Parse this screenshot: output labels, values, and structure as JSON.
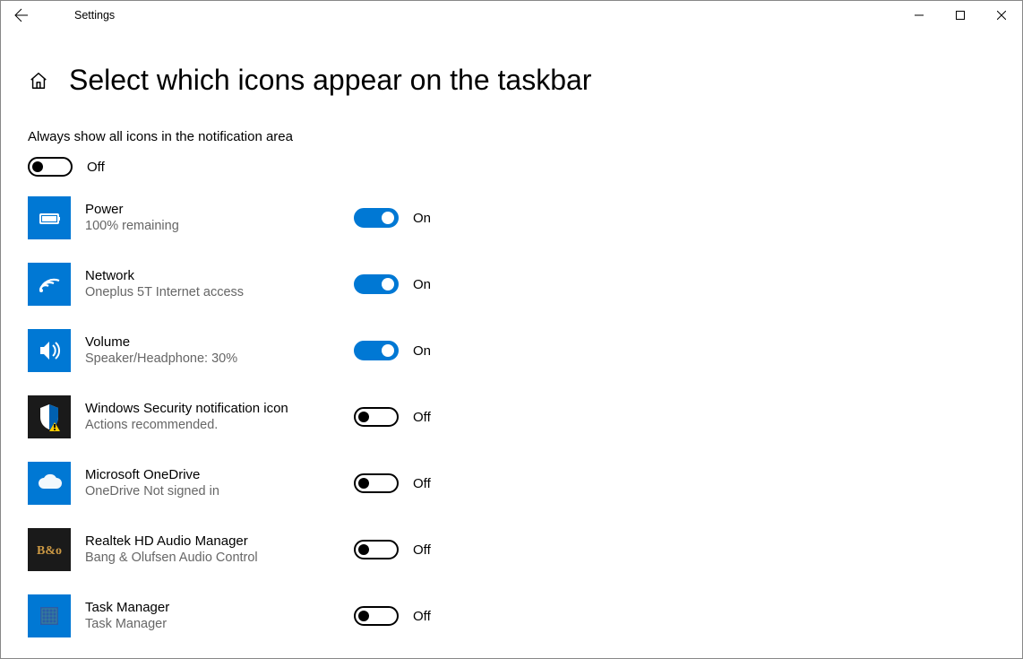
{
  "app_title": "Settings",
  "page_title": "Select which icons appear on the taskbar",
  "master": {
    "label": "Always show all icons in the notification area",
    "state": "Off",
    "on": false
  },
  "items": [
    {
      "title": "Power",
      "sub": "100% remaining",
      "state": "On",
      "on": true,
      "icon": "battery",
      "dark": false
    },
    {
      "title": "Network",
      "sub": "Oneplus 5T Internet access",
      "state": "On",
      "on": true,
      "icon": "wifi",
      "dark": false
    },
    {
      "title": "Volume",
      "sub": "Speaker/Headphone: 30%",
      "state": "On",
      "on": true,
      "icon": "speaker",
      "dark": false
    },
    {
      "title": "Windows Security notification icon",
      "sub": "Actions recommended.",
      "state": "Off",
      "on": false,
      "icon": "shield",
      "dark": true
    },
    {
      "title": "Microsoft OneDrive",
      "sub": "OneDrive Not signed in",
      "state": "Off",
      "on": false,
      "icon": "cloud",
      "dark": false
    },
    {
      "title": "Realtek HD Audio Manager",
      "sub": "Bang & Olufsen Audio Control",
      "state": "Off",
      "on": false,
      "icon": "bo",
      "dark": true
    },
    {
      "title": "Task Manager",
      "sub": "Task Manager",
      "state": "Off",
      "on": false,
      "icon": "chip",
      "dark": false
    }
  ]
}
